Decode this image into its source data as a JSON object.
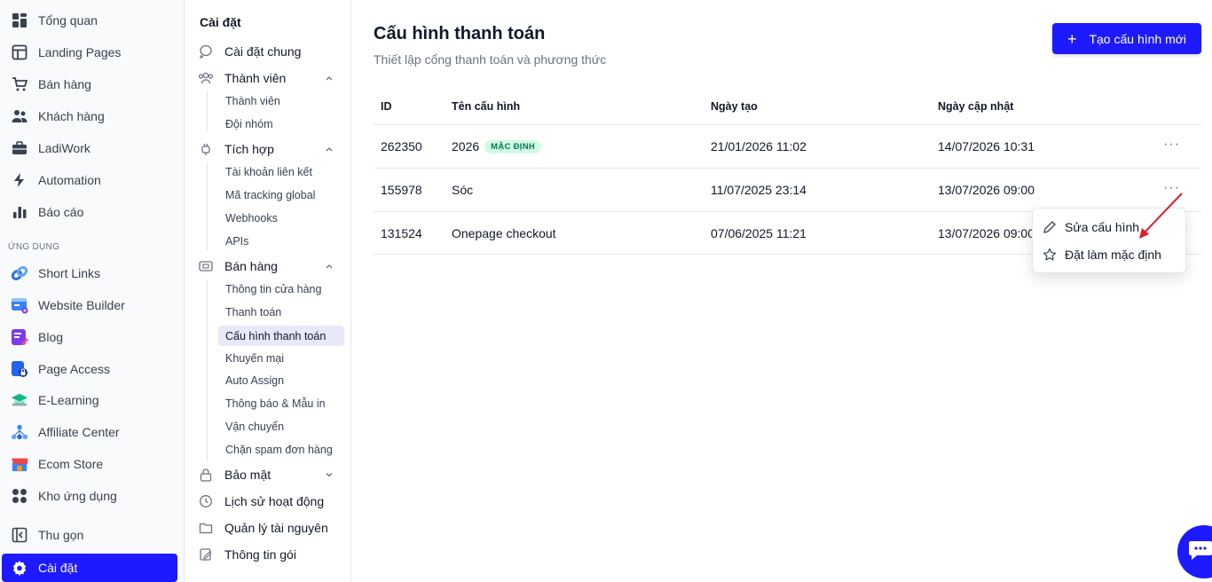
{
  "nav": {
    "items": [
      {
        "label": "Tổng quan",
        "icon": "grid-icon"
      },
      {
        "label": "Landing Pages",
        "icon": "layout-icon"
      },
      {
        "label": "Bán hàng",
        "icon": "cart-icon"
      },
      {
        "label": "Khách hàng",
        "icon": "users-icon"
      },
      {
        "label": "LadiWork",
        "icon": "briefcase-icon"
      },
      {
        "label": "Automation",
        "icon": "bolt-icon"
      },
      {
        "label": "Báo cáo",
        "icon": "bar-chart-icon"
      }
    ],
    "section_label": "ỨNG DỤNG",
    "apps": [
      {
        "label": "Short Links",
        "icon": "link-icon",
        "color": "#2b6fe8"
      },
      {
        "label": "Website Builder",
        "icon": "website-icon",
        "color": "#3b82f6"
      },
      {
        "label": "Blog",
        "icon": "blog-icon",
        "color": "#7c3aed"
      },
      {
        "label": "Page Access",
        "icon": "lock-page-icon",
        "color": "#2563eb"
      },
      {
        "label": "E-Learning",
        "icon": "graduation-icon",
        "color": "#10b981"
      },
      {
        "label": "Affiliate Center",
        "icon": "network-icon",
        "color": "#3b82f6"
      },
      {
        "label": "Ecom Store",
        "icon": "store-icon",
        "color": "#ef4444"
      },
      {
        "label": "Kho ứng dụng",
        "icon": "apps-icon",
        "color": "#374151"
      }
    ],
    "collapse_label": "Thu gọn",
    "active_label": "Cài đặt"
  },
  "settings": {
    "title": "Cài đặt",
    "general": "Cài đặt chung",
    "members": {
      "label": "Thành viên",
      "items": [
        "Thành viên",
        "Đội nhóm"
      ]
    },
    "integrations": {
      "label": "Tích hợp",
      "items": [
        "Tài khoản liên kết",
        "Mã tracking global",
        "Webhooks",
        "APIs"
      ]
    },
    "sales": {
      "label": "Bán hàng",
      "items": [
        "Thông tin cửa hàng",
        "Thanh toán",
        "Cấu hình thanh toán",
        "Khuyến mại",
        "Auto Assign",
        "Thông báo & Mẫu in",
        "Vận chuyển",
        "Chặn spam đơn hàng"
      ]
    },
    "security": "Bảo mật",
    "history": "Lịch sử hoạt động",
    "resources": "Quản lý tài nguyên",
    "plan": "Thông tin gói"
  },
  "main": {
    "title": "Cấu hình thanh toán",
    "subtitle": "Thiết lập cổng thanh toán và phương thức",
    "create_button": "Tạo cấu hình mới",
    "columns": [
      "ID",
      "Tên cấu hình",
      "Ngày tạo",
      "Ngày cập nhật"
    ],
    "rows": [
      {
        "id": "262350",
        "name": "2026",
        "badge": "MẶC ĐỊNH",
        "created": "21/01/2026 11:02",
        "updated": "14/07/2026 10:31"
      },
      {
        "id": "155978",
        "name": "Sóc",
        "badge": "",
        "created": "11/07/2025 23:14",
        "updated": "13/07/2026 09:00"
      },
      {
        "id": "131524",
        "name": "Onepage checkout",
        "badge": "",
        "created": "07/06/2025 11:21",
        "updated": "13/07/2026 09:00"
      }
    ],
    "more_glyph": "···"
  },
  "menu": {
    "edit": "Sửa cấu hình",
    "set_default": "Đặt làm mặc định"
  },
  "colors": {
    "accent": "#1d1aff",
    "badge_bg": "#d1fae5",
    "badge_text": "#047857",
    "annotation": "#e11d2a"
  }
}
